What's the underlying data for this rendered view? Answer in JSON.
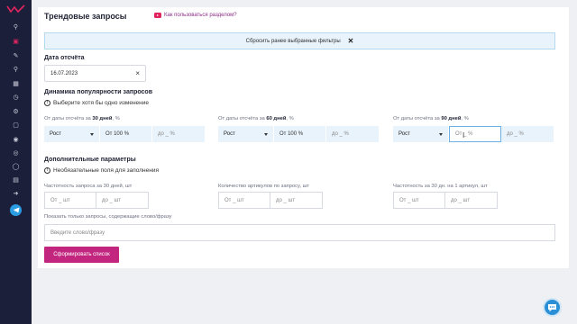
{
  "colors": {
    "sidebar": "#1c1f3a",
    "accent": "#c2267f",
    "link": "#8e2e86",
    "youtube": "#e0245e",
    "telegram": "#2a9de2",
    "chat": "#2a8fd6",
    "filter_bg": "#e8f3fb"
  },
  "sidebar": {
    "icons": [
      "search-icon",
      "bag-icon",
      "edit-icon",
      "zoom-icon",
      "grid-icon",
      "clock-icon",
      "settings-icon",
      "box-icon",
      "user-icon",
      "price-tag-icon",
      "shield-icon",
      "report-icon",
      "logout-icon",
      "telegram-icon"
    ]
  },
  "header": {
    "title": "Трендовые запросы",
    "help_link": "Как пользоваться разделом?"
  },
  "reset": {
    "label": "Сбросить ранее выбранные фильтры"
  },
  "report_date": {
    "label": "Дата отсчёта",
    "value": "16.07.2023"
  },
  "dynamics": {
    "label": "Динамика популярности запросов",
    "hint": "Выберите хотя бы одно изменение",
    "groups": [
      {
        "prefix": "От даты отсчёта за ",
        "period": "30 дней",
        "suffix": ", %",
        "select": "Рост",
        "from": "От 100 %",
        "to": "до _ %"
      },
      {
        "prefix": "От даты отсчёта за ",
        "period": "60 дней",
        "suffix": ", %",
        "select": "Рост",
        "from": "От 100 %",
        "to": "до _ %"
      },
      {
        "prefix": "От даты отсчёта за ",
        "period": "90 дней",
        "suffix": ", %",
        "select": "Рост",
        "from": "От _ %",
        "to": "до _ %"
      }
    ]
  },
  "extra": {
    "label": "Дополнительные параметры",
    "hint": "Необязательные поля для заполнения",
    "fields": [
      {
        "label": "Частотность запроса за 30 дней, шт",
        "from": "От _ шт",
        "to": "до _ шт"
      },
      {
        "label": "Количество артикулов по запросу, шт",
        "from": "От _ шт",
        "to": "до _ шт"
      },
      {
        "label": "Частотность за 30 дн. на 1 артикул, шт",
        "from": "От _ шт",
        "to": "до _ шт"
      }
    ],
    "word_label": "Показать только запросы, содержащие слово/фразу",
    "word_placeholder": "Введите слово/фразу"
  },
  "submit": {
    "label": "Сформировать список"
  }
}
